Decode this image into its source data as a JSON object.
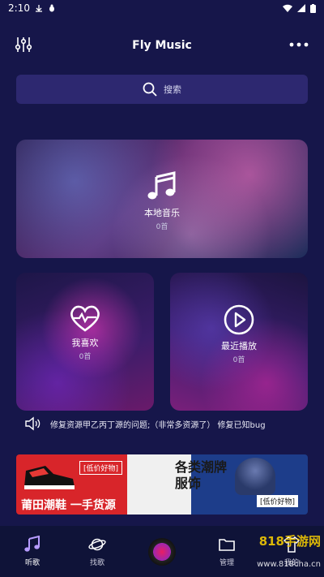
{
  "status_bar": {
    "time": "2:10"
  },
  "header": {
    "title": "Fly Music"
  },
  "search": {
    "label": "搜索"
  },
  "cards": {
    "local": {
      "title": "本地音乐",
      "count": "0首"
    },
    "favorite": {
      "title": "我喜欢",
      "count": "0首"
    },
    "recent": {
      "title": "最近播放",
      "count": "0首"
    }
  },
  "notice": {
    "text": "修复资源甲乙丙丁源的问题;（非常多资源了） 修复已知bug"
  },
  "banner": {
    "tag_left": "[低价好物]",
    "slogan_left": "莆田潮鞋  一手货源",
    "slogan_mid_line1": "各类潮牌",
    "slogan_mid_line2": "服饰",
    "tag_right": "[低价好物]"
  },
  "bottom_nav": {
    "items": [
      {
        "label": "听歌"
      },
      {
        "label": "找歌"
      },
      {
        "label": ""
      },
      {
        "label": "管理"
      },
      {
        "label": "我的"
      }
    ]
  },
  "watermark": {
    "line1": "818手游网",
    "line2": "www.818cha.cn"
  },
  "colors": {
    "background": "#16164a",
    "search_bg": "#2d2870",
    "nav_bg": "#0f1338",
    "accent": "#9a7cff"
  }
}
